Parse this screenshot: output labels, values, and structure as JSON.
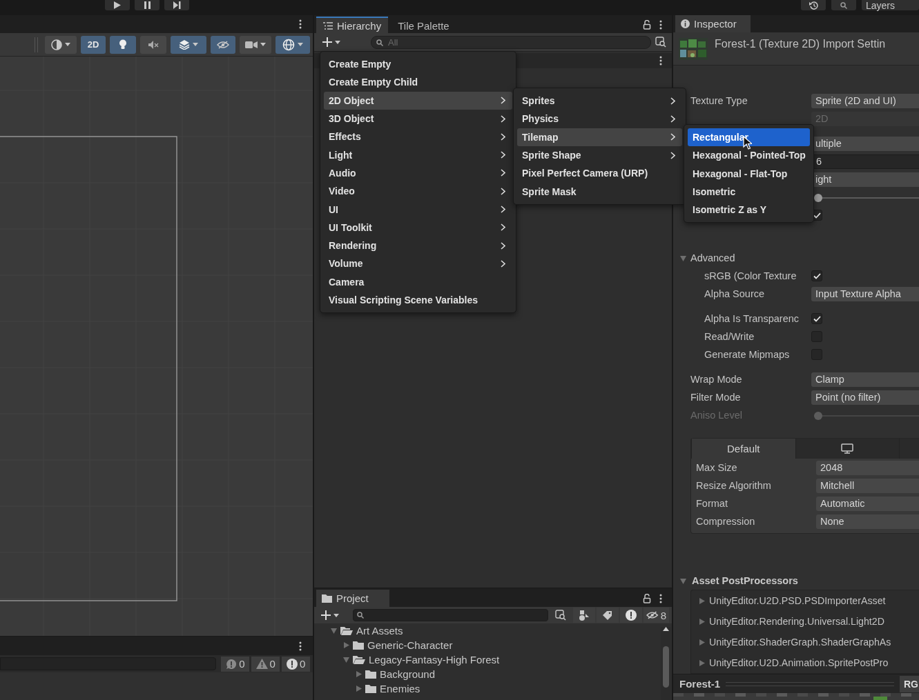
{
  "top_bar": {
    "play_controls": [
      {
        "kind": "play"
      },
      {
        "kind": "pause"
      },
      {
        "kind": "step"
      }
    ],
    "layers": "Layers"
  },
  "scene": {
    "toolbar": [
      {
        "kind": "shading",
        "on": false
      },
      {
        "kind": "label",
        "label": "2D",
        "on": true
      },
      {
        "kind": "light",
        "on": true
      },
      {
        "kind": "audio",
        "on": false
      },
      {
        "kind": "effects",
        "on": true
      },
      {
        "kind": "visibility",
        "on": true
      },
      {
        "kind": "camera",
        "on": false
      },
      {
        "kind": "gizmos",
        "on": true
      }
    ],
    "console_counts": [
      {
        "kind": "info",
        "value": "0"
      },
      {
        "kind": "warning",
        "value": "0"
      },
      {
        "kind": "error",
        "value": "0"
      }
    ]
  },
  "hierarchy": {
    "tabs": [
      {
        "label": "Hierarchy",
        "selected": true
      },
      {
        "label": "Tile Palette",
        "selected": false
      }
    ],
    "search": {
      "placeholder": "All"
    }
  },
  "menus": [
    {
      "items": [
        {
          "label": "Create Empty",
          "submenu": false,
          "selected": false
        },
        {
          "label": "Create Empty Child",
          "submenu": false,
          "selected": false
        },
        {
          "label": "2D Object",
          "submenu": true,
          "selected": true
        },
        {
          "label": "3D Object",
          "submenu": true,
          "selected": false
        },
        {
          "label": "Effects",
          "submenu": true,
          "selected": false
        },
        {
          "label": "Light",
          "submenu": true,
          "selected": false
        },
        {
          "label": "Audio",
          "submenu": true,
          "selected": false
        },
        {
          "label": "Video",
          "submenu": true,
          "selected": false
        },
        {
          "label": "UI",
          "submenu": true,
          "selected": false
        },
        {
          "label": "UI Toolkit",
          "submenu": true,
          "selected": false
        },
        {
          "label": "Rendering",
          "submenu": true,
          "selected": false
        },
        {
          "label": "Volume",
          "submenu": true,
          "selected": false
        },
        {
          "label": "Camera",
          "submenu": false,
          "selected": false
        },
        {
          "label": "Visual Scripting Scene Variables",
          "submenu": false,
          "selected": false
        }
      ]
    },
    {
      "items": [
        {
          "label": "Sprites",
          "submenu": true,
          "selected": false
        },
        {
          "label": "Physics",
          "submenu": true,
          "selected": false
        },
        {
          "label": "Tilemap",
          "submenu": true,
          "selected": true
        },
        {
          "label": "Sprite Shape",
          "submenu": true,
          "selected": false
        },
        {
          "label": "Pixel Perfect Camera (URP)",
          "submenu": false,
          "selected": false
        },
        {
          "label": "Sprite Mask",
          "submenu": false,
          "selected": false
        }
      ]
    },
    {
      "items": [
        {
          "label": "Rectangular",
          "selected": true
        },
        {
          "label": "Hexagonal - Pointed-Top",
          "selected": false
        },
        {
          "label": "Hexagonal - Flat-Top",
          "selected": false
        },
        {
          "label": "Isometric",
          "selected": false
        },
        {
          "label": "Isometric Z as Y",
          "selected": false
        }
      ]
    }
  ],
  "project": {
    "tab": "Project",
    "hidden_count": "8",
    "tree": [
      {
        "label": "Art Assets",
        "expanded": true,
        "children": [
          {
            "label": "Generic-Character",
            "expanded": false
          },
          {
            "label": "Legacy-Fantasy-High Forest",
            "expanded": true,
            "children": [
              {
                "label": "Background",
                "expanded": false
              },
              {
                "label": "Enemies",
                "expanded": false
              }
            ]
          }
        ]
      }
    ]
  },
  "inspector": {
    "tab": "Inspector",
    "title": "Forest-1 (Texture 2D) Import Settin",
    "rows": [
      {
        "kind": "dropdown",
        "label": "Texture Type",
        "value": "Sprite (2D and UI)",
        "disabled": false
      },
      {
        "kind": "dropdown",
        "value": "2D",
        "disabled": true
      },
      {
        "kind": "dropdown",
        "value": "ultiple",
        "disabled": false
      },
      {
        "kind": "field",
        "value": "6",
        "disabled": false
      },
      {
        "kind": "dropdown",
        "value": "ight",
        "disabled": false
      },
      {
        "kind": "slider",
        "level": 0,
        "disabled": false
      },
      {
        "kind": "checkbox",
        "checked": true,
        "disabled": false
      },
      {
        "kind": "foldout",
        "label": "Advanced",
        "expanded": true,
        "disabled": false,
        "children": [
          {
            "kind": "checkbox",
            "label": "sRGB (Color Texture",
            "checked": true,
            "disabled": false
          },
          {
            "kind": "dropdown",
            "label": "Alpha Source",
            "value": "Input Texture Alpha",
            "disabled": false
          },
          {
            "kind": "checkbox",
            "label": "Alpha Is Transparenc",
            "checked": true,
            "disabled": false
          },
          {
            "kind": "checkbox",
            "label": "Read/Write",
            "checked": false,
            "disabled": false
          },
          {
            "kind": "checkbox",
            "label": "Generate Mipmaps",
            "checked": false,
            "disabled": false
          }
        ]
      },
      {
        "kind": "dropdown",
        "label": "Wrap Mode",
        "value": "Clamp",
        "disabled": false
      },
      {
        "kind": "dropdown",
        "label": "Filter Mode",
        "value": "Point (no filter)",
        "disabled": false
      },
      {
        "kind": "slider",
        "label": "Aniso Level",
        "level": 0,
        "disabled": true
      }
    ],
    "platform_tabs": [
      {
        "kind": "label",
        "label": "Default",
        "selected": true
      },
      {
        "kind": "monitor",
        "selected": false
      },
      {
        "kind": "blank",
        "selected": false
      }
    ],
    "platform_rows": [
      {
        "label": "Max Size",
        "value": "2048"
      },
      {
        "label": "Resize Algorithm",
        "value": "Mitchell"
      },
      {
        "label": "Format",
        "value": "Automatic"
      },
      {
        "label": "Compression",
        "value": "None"
      }
    ],
    "postprocessors": {
      "label": "Asset PostProcessors",
      "expanded": true,
      "items": [
        {
          "label": "UnityEditor.U2D.PSD.PSDImporterAsset",
          "expanded": false
        },
        {
          "label": "UnityEditor.Rendering.Universal.Light2D",
          "expanded": false
        },
        {
          "label": "UnityEditor.ShaderGraph.ShaderGraphAs",
          "expanded": false
        },
        {
          "label": "UnityEditor.U2D.Animation.SpritePostPro",
          "expanded": false
        }
      ]
    },
    "preview": {
      "name": "Forest-1",
      "channel": "RG"
    }
  }
}
